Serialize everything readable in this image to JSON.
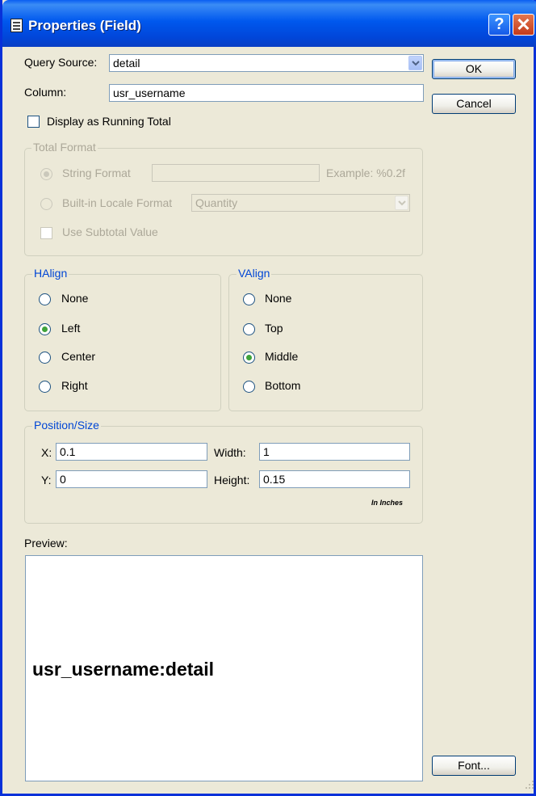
{
  "window": {
    "title": "Properties (Field)",
    "icon": "document-icon",
    "help_label": "?",
    "close_label": "✕"
  },
  "query_source": {
    "label": "Query Source:",
    "value": "detail"
  },
  "column": {
    "label": "Column:",
    "value": "usr_username"
  },
  "running_total": {
    "label": "Display as Running Total",
    "checked": false
  },
  "total_format": {
    "title": "Total Format",
    "string_format": {
      "label": "String Format",
      "value": "",
      "example": "Example: %0.2f"
    },
    "builtin_locale": {
      "label": "Built-in Locale Format",
      "value": "Quantity"
    },
    "use_subtotal": {
      "label": "Use Subtotal Value"
    }
  },
  "halign": {
    "title": "HAlign",
    "options": [
      "None",
      "Left",
      "Center",
      "Right"
    ],
    "selected": "Left"
  },
  "valign": {
    "title": "VAlign",
    "options": [
      "None",
      "Top",
      "Middle",
      "Bottom"
    ],
    "selected": "Middle"
  },
  "position_size": {
    "title": "Position/Size",
    "x_label": "X:",
    "x": "0.1",
    "y_label": "Y:",
    "y": "0",
    "width_label": "Width:",
    "width": "1",
    "height_label": "Height:",
    "height": "0.15",
    "units": "In Inches"
  },
  "preview": {
    "label": "Preview:",
    "text": "usr_username:detail"
  },
  "buttons": {
    "ok": "OK",
    "cancel": "Cancel",
    "font": "Font..."
  },
  "colors": {
    "title_bar": "#0058ee",
    "dialog_bg": "#ece9d8",
    "group_title": "#0046d5"
  }
}
